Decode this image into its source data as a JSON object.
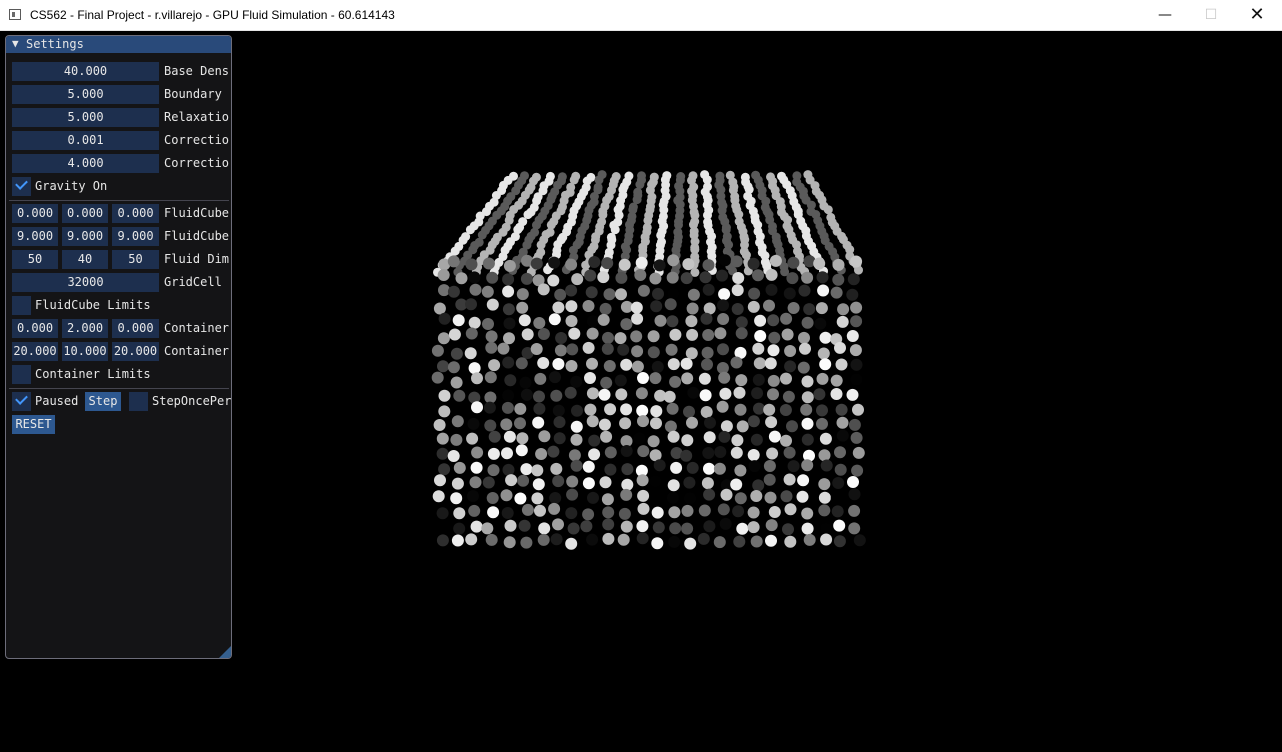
{
  "window": {
    "title": "CS562 - Final Project - r.villarejo - GPU Fluid Simulation - 60.614143",
    "minimize": "—",
    "maximize": "☐",
    "close": "✕"
  },
  "panel": {
    "arrow": "▼",
    "title": "Settings",
    "base_density": {
      "value": "40.000",
      "label": "Base Dens"
    },
    "boundary": {
      "value": "5.000",
      "label": "Boundary"
    },
    "relaxation": {
      "value": "5.000",
      "label": "Relaxatio"
    },
    "correction1": {
      "value": "0.001",
      "label": "Correctio"
    },
    "correction2": {
      "value": "4.000",
      "label": "Correctio"
    },
    "gravity": {
      "label": "Gravity On",
      "checked": true
    },
    "fluidcube_min": {
      "values": [
        "0.000",
        "0.000",
        "0.000"
      ],
      "label": "FluidCube"
    },
    "fluidcube_max": {
      "values": [
        "9.000",
        "9.000",
        "9.000"
      ],
      "label": "FluidCube"
    },
    "fluid_dim": {
      "values": [
        "50",
        "40",
        "50"
      ],
      "label": "Fluid Dim"
    },
    "gridcell": {
      "value": "32000",
      "label": "GridCell"
    },
    "fluidcube_limits": {
      "label": "FluidCube Limits",
      "checked": false
    },
    "container_min": {
      "values": [
        "0.000",
        "2.000",
        "0.000"
      ],
      "label": "Container"
    },
    "container_max": {
      "values": [
        "20.000",
        "10.000",
        "20.000"
      ],
      "label": "Container"
    },
    "container_limits": {
      "label": "Container Limits",
      "checked": false
    },
    "paused": {
      "label": "Paused",
      "checked": true
    },
    "step_label": "Step",
    "step_once": {
      "label": "StepOncePer",
      "checked": false
    },
    "reset_label": "RESET"
  },
  "colors": {
    "panel_bg": "#151517",
    "header_bg": "#294a7a",
    "field_bg": "#1d2f4e",
    "button_bg": "#2d5890",
    "check_color": "#4296fa",
    "viewport_bg": "#000000"
  },
  "icons": {
    "app": "app-window-icon",
    "collapse": "triangle-down-icon",
    "check": "checkmark-icon",
    "grip": "resize-grip-icon"
  }
}
